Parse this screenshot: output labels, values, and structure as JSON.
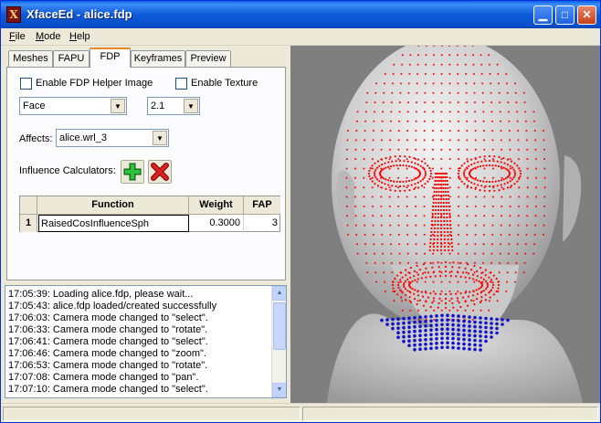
{
  "window": {
    "title": "XfaceEd - alice.fdp",
    "app_icon": "X"
  },
  "titlebar_buttons": [
    "minimize-icon",
    "maximize-icon",
    "close-icon"
  ],
  "menu": {
    "file": "F",
    "file_rest": "ile",
    "mode": "M",
    "mode_rest": "ode",
    "help": "H",
    "help_rest": "elp"
  },
  "tabs": [
    "Meshes",
    "FAPU",
    "FDP",
    "Keyframes",
    "Preview"
  ],
  "active_tab": "FDP",
  "fdp": {
    "enable_helper": "Enable FDP Helper Image",
    "enable_texture": "Enable Texture",
    "region_combo": "Face",
    "version_combo": "2.1",
    "affects_label": "Affects:",
    "affects_value": "alice.wrl_3",
    "influence_label": "Influence Calculators:"
  },
  "grid": {
    "headers": [
      "",
      "Function",
      "Weight",
      "FAP"
    ],
    "rows": [
      {
        "index": "1",
        "function": "RaisedCosInfluenceSph",
        "weight": "0.3000",
        "fap": "3"
      }
    ]
  },
  "log": [
    "17:05:39: Loading alice.fdp, please wait...",
    "17:05:43: alice.fdp loaded/created successfully",
    "17:06:03: Camera mode changed to \"select\".",
    "17:06:33: Camera mode changed to \"rotate\".",
    "17:06:41: Camera mode changed to \"select\".",
    "17:06:46: Camera mode changed to \"zoom\".",
    "17:06:53: Camera mode changed to \"rotate\".",
    "17:07:08: Camera mode changed to \"pan\".",
    "17:07:10: Camera mode changed to \"select\"."
  ],
  "colors": {
    "mesh_points": "#ff0000",
    "selected_points": "#1010cc",
    "viewport_bg": "#7f7f7f"
  }
}
